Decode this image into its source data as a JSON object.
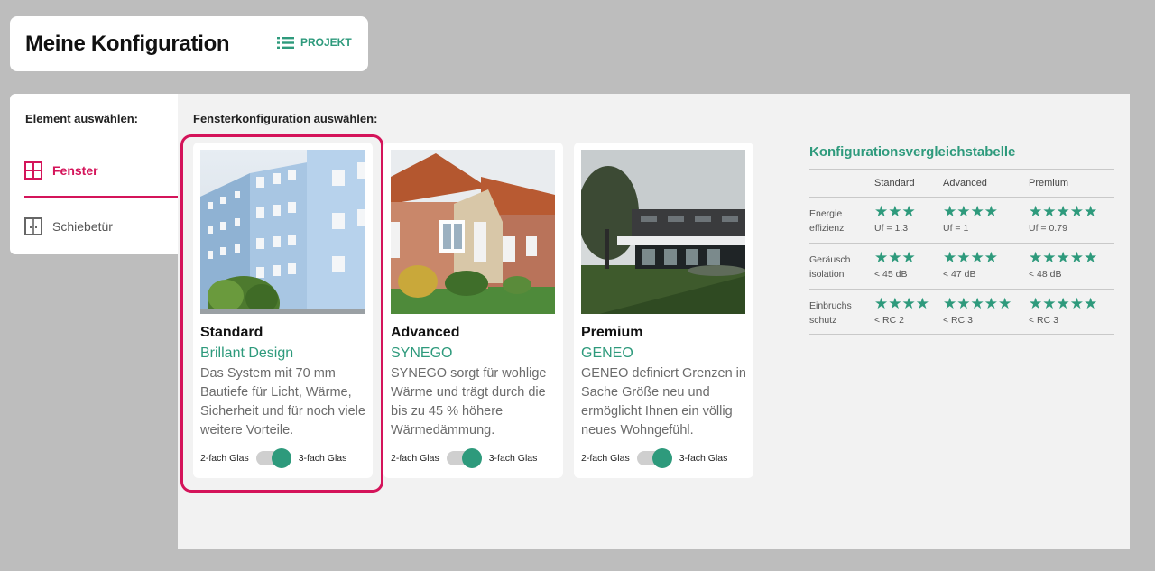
{
  "header": {
    "title": "Meine Konfiguration",
    "project_label": "PROJEKT"
  },
  "sidebar": {
    "heading": "Element auswählen:",
    "items": [
      {
        "label": "Fenster",
        "icon": "window-icon",
        "active": true
      },
      {
        "label": "Schiebetür",
        "icon": "sliding-door-icon",
        "active": false
      }
    ]
  },
  "main": {
    "heading": "Fensterkonfiguration auswählen:",
    "cards": [
      {
        "title": "Standard",
        "subtitle": "Brillant Design",
        "description": "Das System mit 70 mm Bautiefe für Licht, Wärme, Sicherheit und für noch viele weitere Vorteile.",
        "glass_left": "2-fach Glas",
        "glass_right": "3-fach Glas",
        "selected": true
      },
      {
        "title": "Advanced",
        "subtitle": "SYNEGO",
        "description": "SYNEGO sorgt für wohlige Wärme und trägt durch die bis zu 45 % höhere Wärmedämmung.",
        "glass_left": "2-fach Glas",
        "glass_right": "3-fach Glas",
        "selected": false
      },
      {
        "title": "Premium",
        "subtitle": "GENEO",
        "description": "GENEO definiert Grenzen in Sache Größe neu und ermöglicht Ihnen ein völlig neues Wohngefühl.",
        "glass_left": "2-fach Glas",
        "glass_right": "3-fach Glas",
        "selected": false
      }
    ]
  },
  "comparison": {
    "title": "Konfigurationsvergleichstabelle",
    "columns": [
      "Standard",
      "Advanced",
      "Premium"
    ],
    "rows": [
      {
        "label_1": "Energie",
        "label_2": "effizienz",
        "cells": [
          {
            "stars": "★★★",
            "value": "Uf = 1.3"
          },
          {
            "stars": "★★★★",
            "value": "Uf = 1"
          },
          {
            "stars": "★★★★★",
            "value": "Uf = 0.79"
          }
        ]
      },
      {
        "label_1": "Geräusch",
        "label_2": "isolation",
        "cells": [
          {
            "stars": "★★★",
            "value": "< 45 dB"
          },
          {
            "stars": "★★★★",
            "value": "< 47 dB"
          },
          {
            "stars": "★★★★★",
            "value": "< 48 dB"
          }
        ]
      },
      {
        "label_1": "Einbruchs",
        "label_2": "schutz",
        "cells": [
          {
            "stars": "★★★★",
            "value": "< RC 2"
          },
          {
            "stars": "★★★★★",
            "value": "< RC 3"
          },
          {
            "stars": "★★★★★",
            "value": "< RC 3"
          }
        ]
      }
    ]
  },
  "colors": {
    "accent": "#2e9a7c",
    "highlight": "#d4145a",
    "panel": "#f2f2f2",
    "backdrop": "#bdbdbd"
  }
}
